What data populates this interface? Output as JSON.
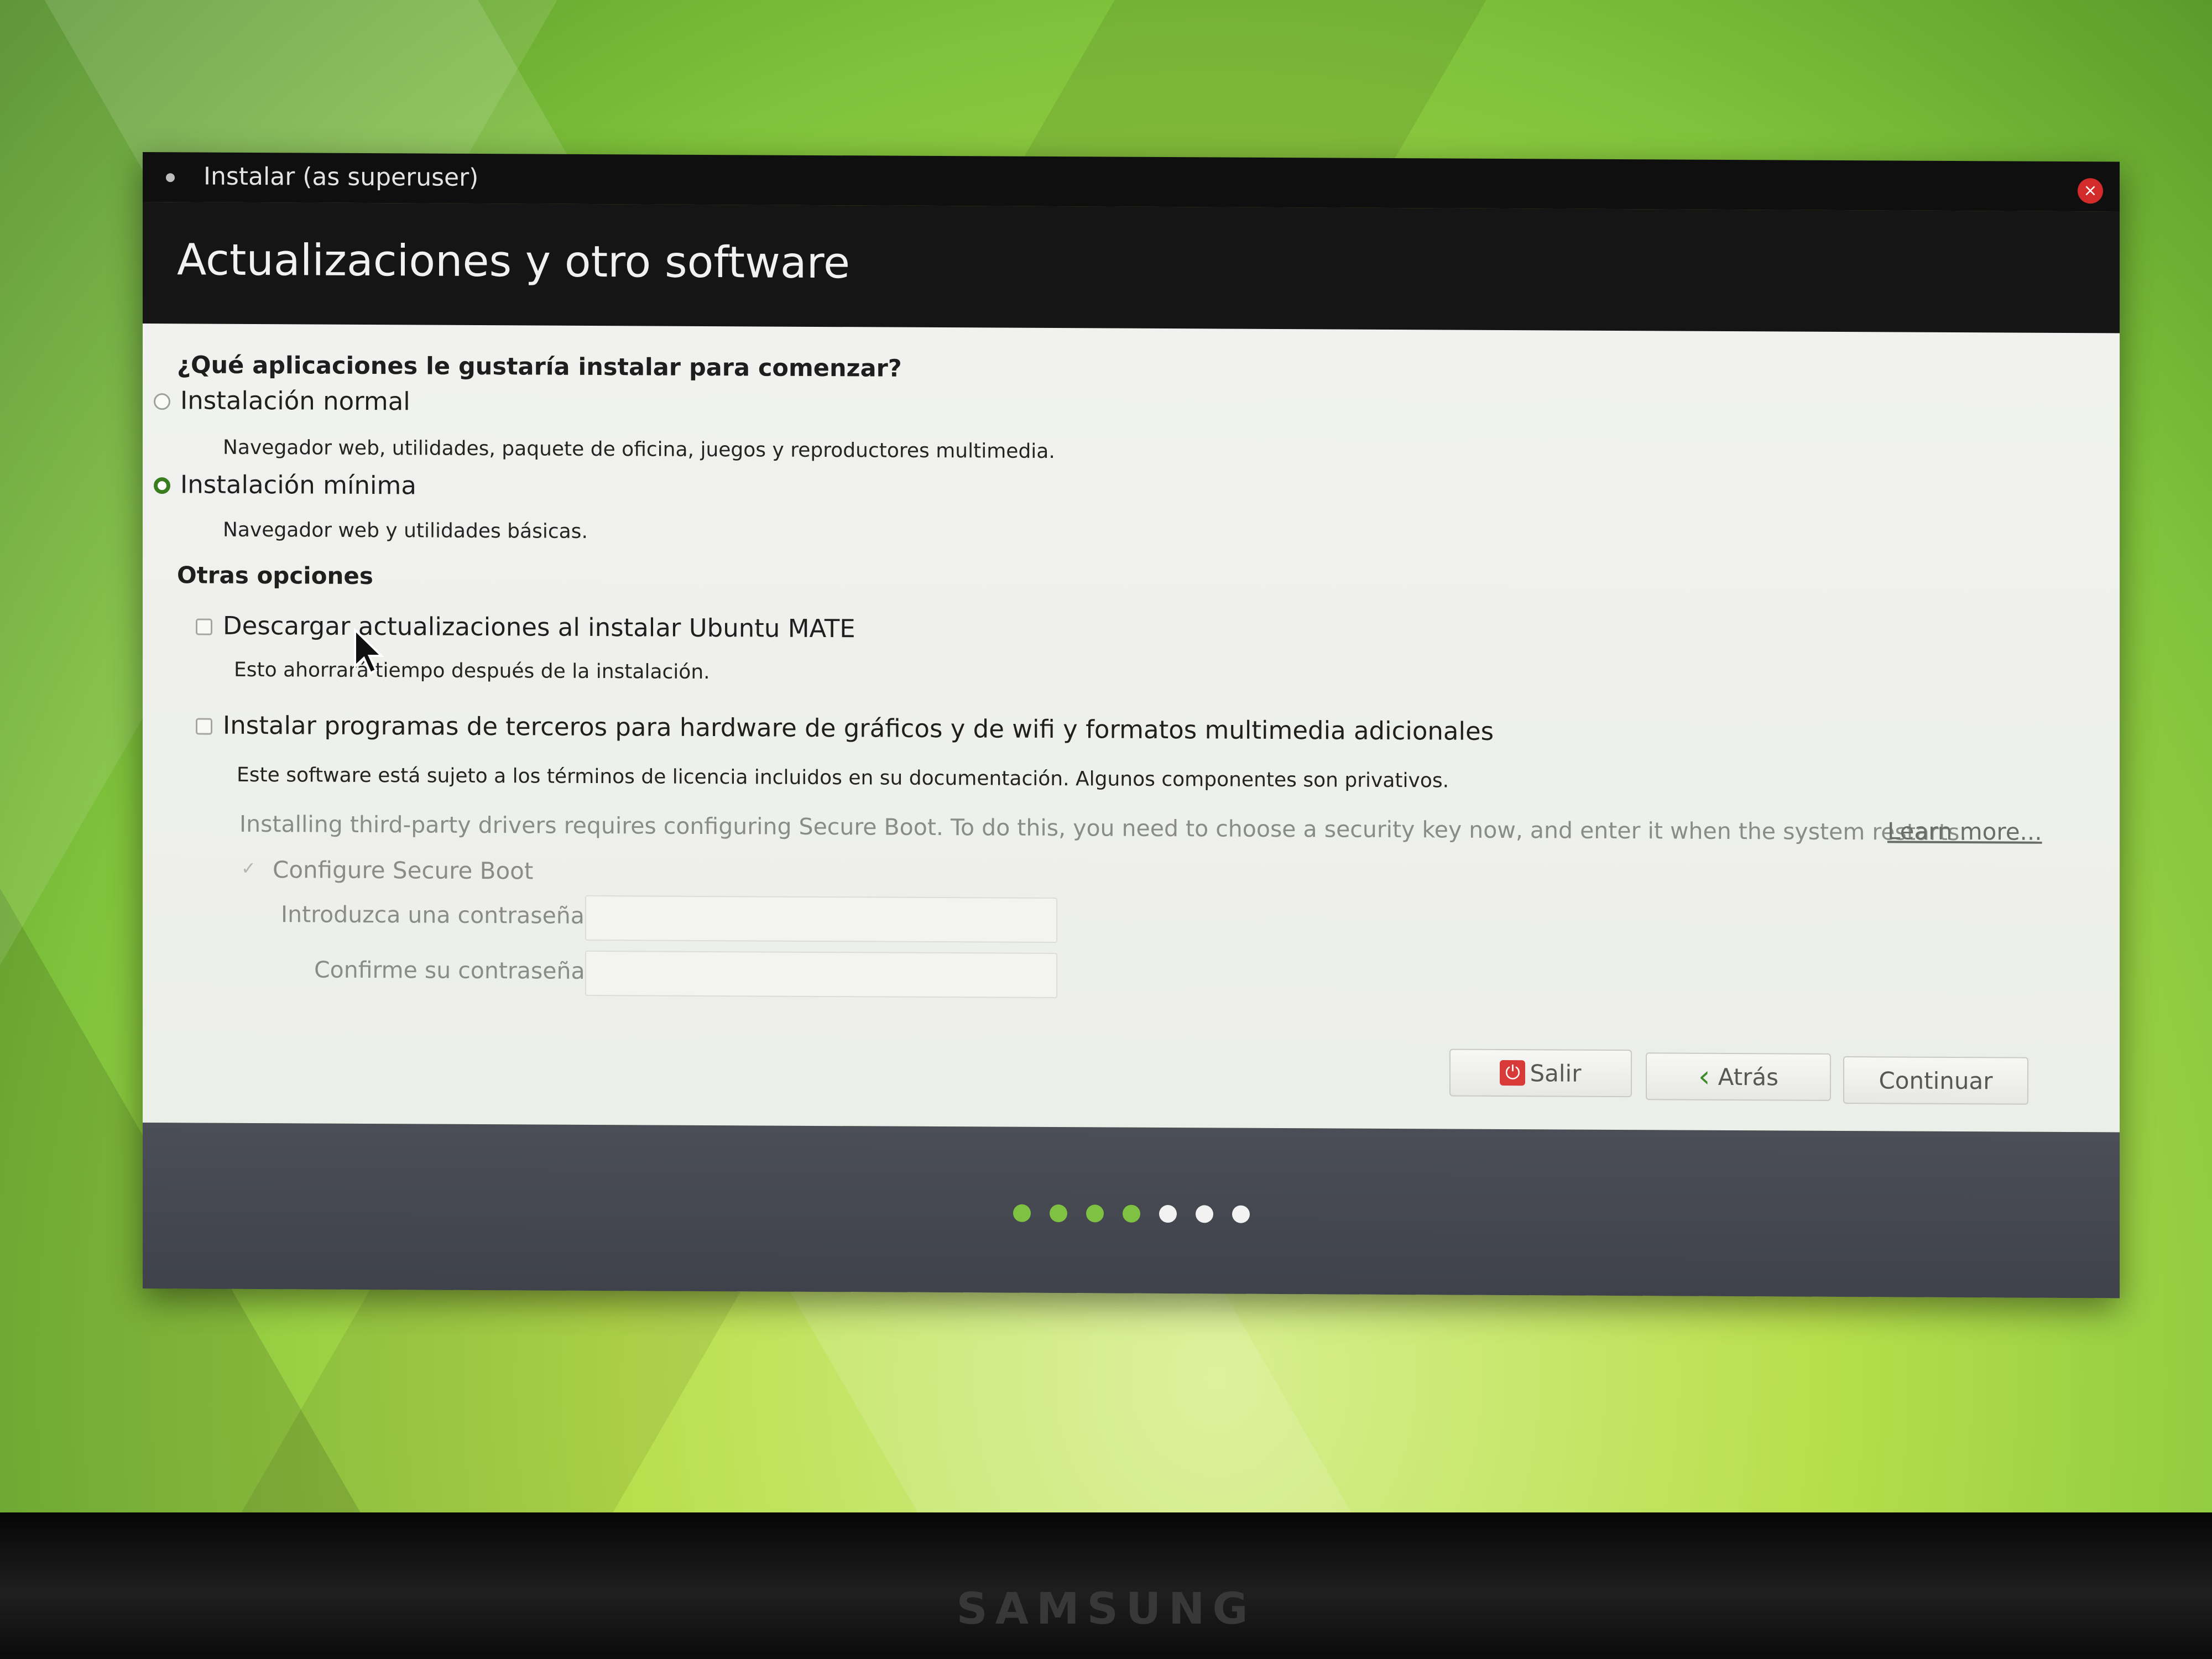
{
  "window": {
    "title": "Instalar (as superuser)",
    "close_glyph": "×"
  },
  "page": {
    "heading": "Actualizaciones y otro software",
    "question": "¿Qué aplicaciones le gustaría instalar para comenzar?"
  },
  "options": {
    "normal": {
      "label": "Instalación normal",
      "description": "Navegador web, utilidades, paquete de oficina, juegos y reproductores multimedia.",
      "selected": false
    },
    "minimal": {
      "label": "Instalación mínima",
      "description": "Navegador web y utilidades básicas.",
      "selected": true
    }
  },
  "other_options": {
    "heading": "Otras opciones",
    "download_updates": {
      "label": "Descargar actualizaciones al instalar Ubuntu MATE",
      "description": "Esto ahorrará tiempo después de la instalación.",
      "checked": false
    },
    "third_party": {
      "label": "Instalar programas de terceros para hardware de gráficos y de wifi y formatos multimedia adicionales",
      "description": "Este software está sujeto a los términos de licencia incluidos en su documentación. Algunos componentes son privativos.",
      "checked": false
    },
    "secure_boot": {
      "notice": "Installing third-party drivers requires configuring Secure Boot. To do this, you need to choose a security key now, and enter it when the system restarts.",
      "learn_more": "Learn more...",
      "configure_label": "Configure Secure Boot",
      "password_label": "Introduzca una contraseña:",
      "confirm_label": "Confirme su contraseña:",
      "password_value": "",
      "confirm_value": ""
    }
  },
  "buttons": {
    "quit": "Salir",
    "back": "Atrás",
    "continue": "Continuar"
  },
  "progress": {
    "total_steps": 7,
    "completed_steps": 4
  },
  "monitor": {
    "brand": "SAMSUNG"
  },
  "colors": {
    "accent": "#3a7d1f",
    "progress_done": "#7fc243",
    "progress_todo": "#f2f2f2",
    "close_button": "#d32b2b",
    "quit_icon": "#d83a3a"
  }
}
